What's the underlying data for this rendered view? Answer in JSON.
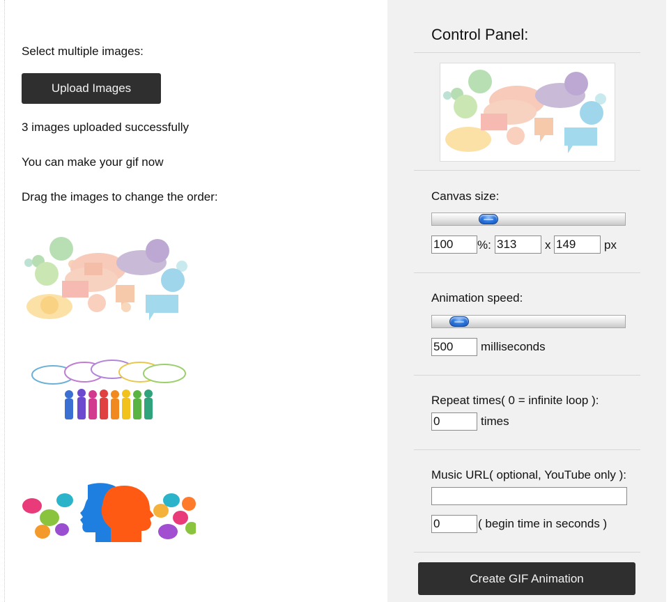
{
  "left": {
    "select_label": "Select multiple images:",
    "upload_label": "Upload Images",
    "status_text": "3 images uploaded successfully",
    "hint_text": "You can make your gif now",
    "drag_text": "Drag the images to change the order:",
    "images": [
      "social-media-cloud-icons-image",
      "people-speech-bubbles-image",
      "two-heads-profile-image"
    ]
  },
  "panel": {
    "title": "Control Panel:",
    "preview": "social-media-cloud-icons-image",
    "canvas": {
      "label": "Canvas size:",
      "percent": "100",
      "pct_suffix": "%:",
      "width": "313",
      "x_sep": "x",
      "height": "149",
      "unit": "px",
      "slider_fraction": 0.27
    },
    "speed": {
      "label": "Animation speed:",
      "value": "500",
      "unit": "milliseconds",
      "slider_fraction": 0.1
    },
    "repeat": {
      "label": "Repeat times( 0 = infinite loop ):",
      "value": "0",
      "unit": "times"
    },
    "music": {
      "label": "Music URL( optional, YouTube only ):",
      "url": "",
      "begin": "0",
      "begin_label": "( begin time in seconds )"
    },
    "create_label": "Create GIF Animation"
  },
  "colors": {
    "button_bg": "#2f2f2f",
    "panel_bg": "#f1f1f1",
    "slider_thumb": "#2d78e0"
  }
}
